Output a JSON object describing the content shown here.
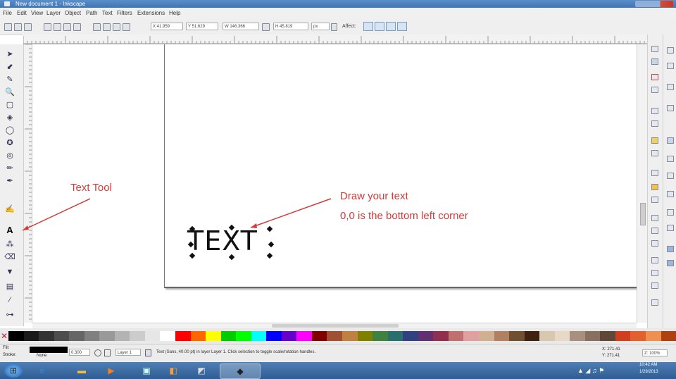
{
  "window": {
    "title": "New document 1 - Inkscape"
  },
  "menu": [
    "File",
    "Edit",
    "View",
    "Layer",
    "Object",
    "Path",
    "Text",
    "Filters",
    "Extensions",
    "Help"
  ],
  "toolbar": {
    "x_value": "X 41.959",
    "y_value": "Y 51.629",
    "w_value": "W 146.366",
    "h_value": "H 45.819",
    "units": "px",
    "affect_label": "Affect:"
  },
  "canvas": {
    "text_object": "TEXT",
    "annotation_tool": "Text Tool",
    "annotation_draw_line1": "Draw your text",
    "annotation_draw_line2": "0,0 is the bottom left corner"
  },
  "status": {
    "fill_label": "Fill:",
    "stroke_label": "Stroke:",
    "stroke_value": "None",
    "opacity": "0.300",
    "layer": "Layer 1",
    "message": "Text (Sans, 40.00 pt) in layer Layer 1. Click selection to toggle scale/rotation handles.",
    "coords_x": "X: 271.41",
    "coords_y": "Y: 271.41",
    "zoom": "Z: 100%"
  },
  "tray": {
    "time": "10:42 AM",
    "date": "1/29/2013"
  },
  "colors": {
    "accent": "#3f74b4",
    "annotation": "#d43a3a",
    "palette": [
      "#000000",
      "#1a1a1a",
      "#333333",
      "#4d4d4d",
      "#666666",
      "#808080",
      "#999999",
      "#b3b3b3",
      "#cccccc",
      "#e6e6e6",
      "#ffffff",
      "#ff0000",
      "#ff6600",
      "#ffff00",
      "#00cc00",
      "#00ff00",
      "#00ffff",
      "#0000ff",
      "#6600cc",
      "#ff00ff",
      "#800000",
      "#a05030",
      "#c08040",
      "#808000",
      "#408040",
      "#2a6e6e",
      "#304080",
      "#603070",
      "#903050",
      "#c07070",
      "#e0a0a0",
      "#d0b090",
      "#b08060",
      "#705030",
      "#402010",
      "#d8c8b0",
      "#e8d8c8",
      "#a89080",
      "#887060",
      "#604838",
      "#d04020",
      "#e06030",
      "#f09050",
      "#b04010"
    ]
  },
  "icons": {
    "tools": [
      "selector-icon",
      "node-icon",
      "tweak-icon",
      "zoom-icon",
      "rect-icon",
      "3dbox-icon",
      "ellipse-icon",
      "star-icon",
      "spiral-icon",
      "pencil-icon",
      "pen-icon",
      "calligraphy-icon",
      "text-icon",
      "spray-icon",
      "eraser-icon",
      "bucket-icon",
      "gradient-icon",
      "dropper-icon",
      "connector-icon"
    ]
  }
}
